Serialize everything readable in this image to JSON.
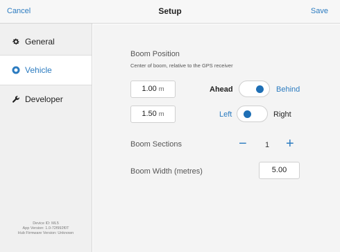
{
  "navbar": {
    "cancel_label": "Cancel",
    "title": "Setup",
    "save_label": "Save"
  },
  "sidebar": {
    "items": [
      {
        "label": "General",
        "icon": "gear-icon",
        "selected": false
      },
      {
        "label": "Vehicle",
        "icon": "vehicle-radio-icon",
        "selected": true
      },
      {
        "label": "Developer",
        "icon": "wrench-icon",
        "selected": false
      }
    ],
    "footer": {
      "device_id": "Device ID: ML5",
      "app_version": "App Version: 1.0-72f992f0T",
      "firmware_version": "Hub Firmware Version: Unknown"
    }
  },
  "boom_position": {
    "title": "Boom Position",
    "subtitle": "Center of boom, relative to the GPS receiver",
    "longitudinal": {
      "value": "1.00",
      "unit": "m",
      "left_label": "Ahead",
      "right_label": "Behind",
      "selected": "Behind"
    },
    "lateral": {
      "value": "1.50",
      "unit": "m",
      "left_label": "Left",
      "right_label": "Right",
      "selected": "Left"
    }
  },
  "boom_sections": {
    "label": "Boom Sections",
    "minus": "−",
    "value": "1",
    "plus": "+"
  },
  "boom_width": {
    "label": "Boom Width (metres)",
    "value": "5.00"
  },
  "colors": {
    "accent": "#2b7bc0",
    "knob": "#1e6fb5",
    "sidebar_bg": "#f0f0f0",
    "content_bg": "#f4f4f4"
  }
}
